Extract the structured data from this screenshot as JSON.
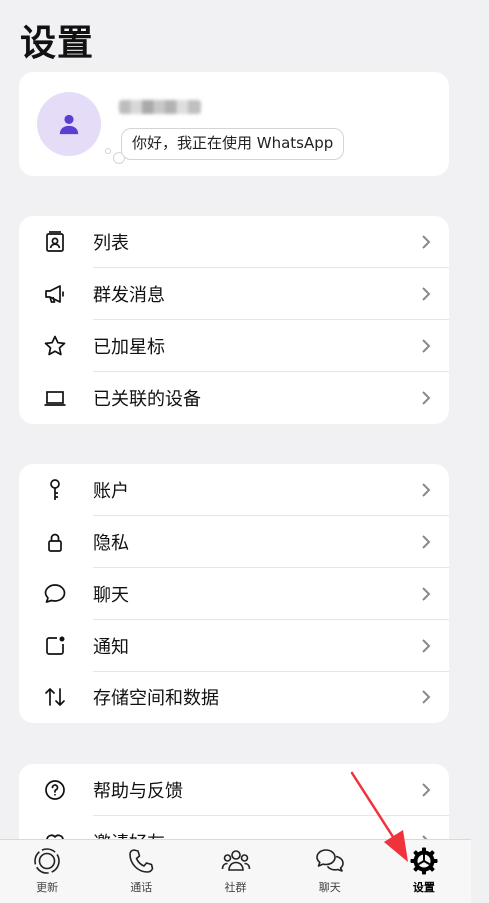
{
  "page": {
    "title": "设置"
  },
  "profile": {
    "status": "你好，我正在使用 WhatsApp"
  },
  "groups": [
    {
      "items": [
        {
          "icon": "contact-list-icon",
          "label": "列表"
        },
        {
          "icon": "megaphone-icon",
          "label": "群发消息"
        },
        {
          "icon": "star-icon",
          "label": "已加星标"
        },
        {
          "icon": "laptop-icon",
          "label": "已关联的设备"
        }
      ]
    },
    {
      "items": [
        {
          "icon": "key-icon",
          "label": "账户"
        },
        {
          "icon": "lock-icon",
          "label": "隐私"
        },
        {
          "icon": "chat-bubble-icon",
          "label": "聊天"
        },
        {
          "icon": "notification-icon",
          "label": "通知"
        },
        {
          "icon": "storage-arrows-icon",
          "label": "存储空间和数据"
        }
      ]
    },
    {
      "items": [
        {
          "icon": "help-icon",
          "label": "帮助与反馈"
        },
        {
          "icon": "heart-icon",
          "label": "邀请好友"
        }
      ]
    }
  ],
  "tabbar": {
    "tabs": [
      {
        "icon": "updates-icon",
        "label": "更新"
      },
      {
        "icon": "phone-icon",
        "label": "通话"
      },
      {
        "icon": "community-icon",
        "label": "社群"
      },
      {
        "icon": "chats-icon",
        "label": "聊天"
      },
      {
        "icon": "settings-gear-icon",
        "label": "设置",
        "active": true
      }
    ]
  },
  "colors": {
    "accent_arrow": "#f0323c",
    "avatar_bg": "#e5dcf7",
    "avatar_fg": "#5b3fd1"
  }
}
